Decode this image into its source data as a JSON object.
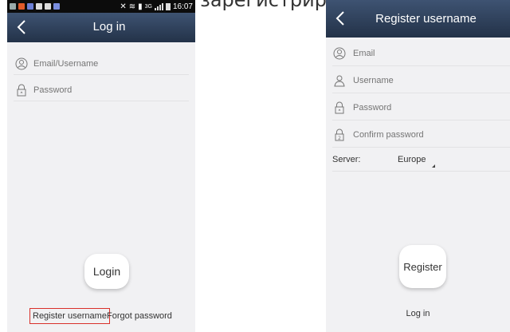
{
  "caption": "ваны, то зарегистрируйтесь:",
  "login_screen": {
    "status_bar": {
      "time": "16:07",
      "network": "3G"
    },
    "title": "Log in",
    "fields": {
      "email_placeholder": "Email/Username",
      "password_placeholder": "Password"
    },
    "login_button": "Login",
    "register_link": "Register username",
    "forgot_link": "Forgot password",
    "colors": {
      "header": "#2c3d57",
      "highlight_border": "#d9302a"
    }
  },
  "register_screen": {
    "title": "Register username",
    "fields": {
      "email_placeholder": "Email",
      "username_placeholder": "Username",
      "password_placeholder": "Password",
      "confirm_placeholder": "Confirm password"
    },
    "server_label": "Server:",
    "server_value": "Europe",
    "register_button": "Register",
    "login_link": "Log in"
  }
}
